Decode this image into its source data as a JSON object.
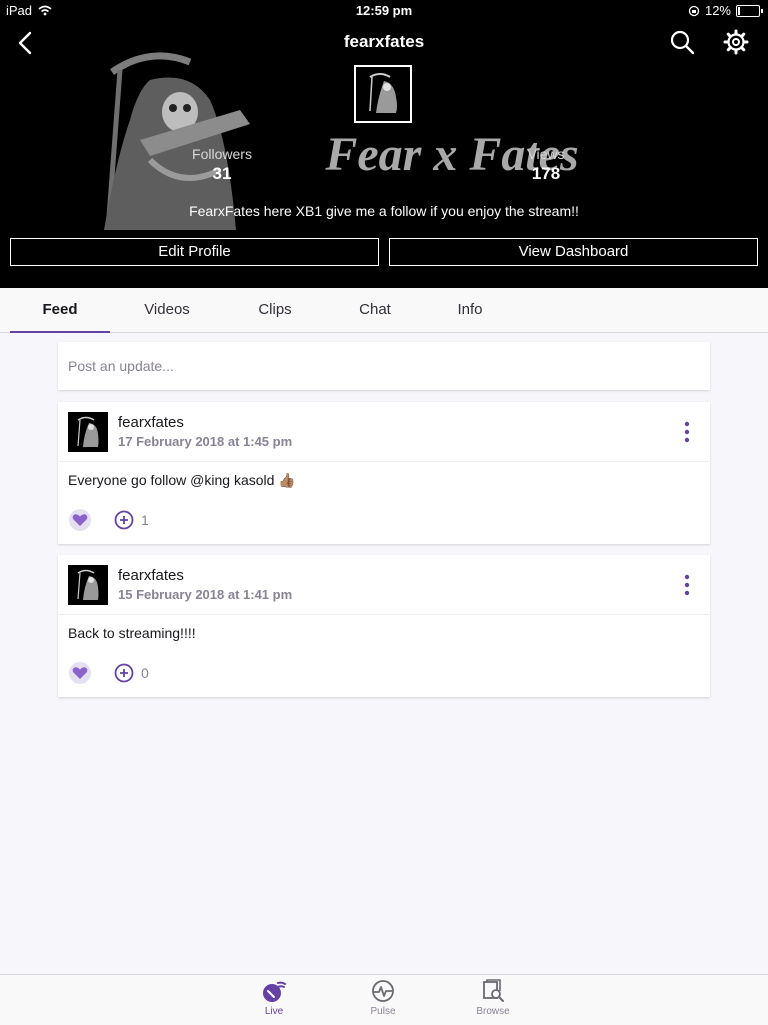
{
  "status_bar": {
    "device": "iPad",
    "time": "12:59 pm",
    "battery": "12%",
    "battery_level": 0.12
  },
  "header": {
    "title": "fearxfates",
    "banner_text": "Fear x Fates",
    "stats": [
      {
        "label": "Followers",
        "value": "31"
      },
      {
        "label": "Views",
        "value": "178"
      }
    ],
    "bio": "FearxFates here XB1 give me a follow if you enjoy the stream!!",
    "edit_profile_label": "Edit Profile",
    "view_dashboard_label": "View Dashboard"
  },
  "tabs": [
    {
      "label": "Feed",
      "active": true
    },
    {
      "label": "Videos",
      "active": false
    },
    {
      "label": "Clips",
      "active": false
    },
    {
      "label": "Chat",
      "active": false
    },
    {
      "label": "Info",
      "active": false
    }
  ],
  "composer": {
    "placeholder": "Post an update..."
  },
  "posts": [
    {
      "author": "fearxfates",
      "date": "17 February 2018 at 1:45 pm",
      "text": "Everyone go follow @king kasold 👍🏽",
      "reaction_count": "1"
    },
    {
      "author": "fearxfates",
      "date": "15 February 2018 at 1:41 pm",
      "text": "Back to streaming!!!!",
      "reaction_count": "0"
    }
  ],
  "bottom_nav": [
    {
      "label": "Live",
      "icon": "live-icon",
      "active": true
    },
    {
      "label": "Pulse",
      "icon": "pulse-icon",
      "active": false
    },
    {
      "label": "Browse",
      "icon": "browse-icon",
      "active": false
    }
  ],
  "colors": {
    "accent": "#6441a4",
    "header_bg": "#000000",
    "page_bg": "#f7f6fa"
  }
}
